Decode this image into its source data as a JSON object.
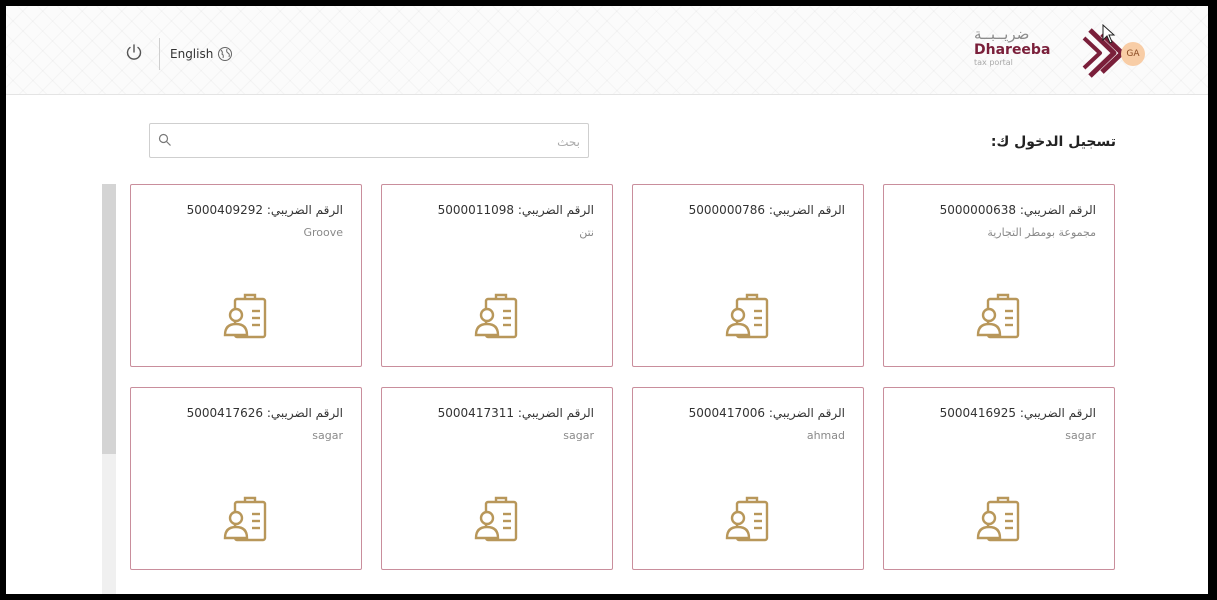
{
  "header": {
    "language_label": "English",
    "logo_arabic": "ضريــبــة",
    "logo_english": "Dhareeba",
    "logo_sub": "tax portal",
    "avatar_initials": "GA"
  },
  "page_title": "تسجيل الدخول ك:",
  "search": {
    "placeholder": "بحث",
    "value": ""
  },
  "cards": [
    {
      "tin": "الرقم الضريبي: 5000000638",
      "name": "مجموعة بومطر التجارية"
    },
    {
      "tin": "الرقم الضريبي: 5000000786",
      "name": ""
    },
    {
      "tin": "الرقم الضريبي: 5000011098",
      "name": "نتن"
    },
    {
      "tin": "الرقم الضريبي: 5000409292",
      "name": "Groove"
    },
    {
      "tin": "الرقم الضريبي: 5000416925",
      "name": "sagar"
    },
    {
      "tin": "الرقم الضريبي: 5000417006",
      "name": "ahmad"
    },
    {
      "tin": "الرقم الضريبي: 5000417311",
      "name": "sagar"
    },
    {
      "tin": "الرقم الضريبي: 5000417626",
      "name": "sagar"
    }
  ],
  "colors": {
    "accent": "#7a1f3a",
    "icon_gold": "#b8975a",
    "card_border": "#c98e9c"
  }
}
